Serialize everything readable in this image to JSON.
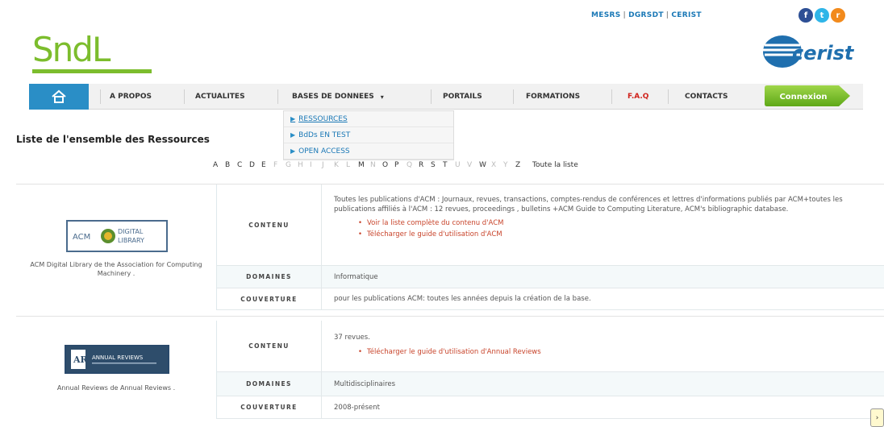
{
  "header": {
    "toplinks": [
      "MESRS",
      "DGRSDT",
      "CERIST"
    ],
    "logo_text": "SndL",
    "cerist_logo_text": "cerist"
  },
  "social": {
    "facebook": "f",
    "twitter": "t",
    "rss": "r"
  },
  "nav": {
    "items": [
      "A PROPOS",
      "ACTUALITES",
      "BASES DE DONNEES",
      "PORTAILS",
      "FORMATIONS",
      "F.A.Q",
      "CONTACTS"
    ],
    "dropdown_caret": "▾",
    "connexion_label": "Connexion"
  },
  "dropdown": {
    "items": [
      "RESSOURCES",
      "BdDs EN TEST",
      "OPEN ACCESS"
    ]
  },
  "page": {
    "title": "Liste de l'ensemble des Ressources"
  },
  "alphabet": {
    "letters": [
      "A",
      "B",
      "C",
      "D",
      "E",
      "F",
      "G",
      "H",
      "I",
      "J",
      "K",
      "L",
      "M",
      "N",
      "O",
      "P",
      "Q",
      "R",
      "S",
      "T",
      "U",
      "V",
      "W",
      "X",
      "Y",
      "Z"
    ],
    "all_label": "Toute la liste"
  },
  "resources": [
    {
      "logo_left": "ACM",
      "logo_right_1": "DIGITAL",
      "logo_right_2": "LIBRARY",
      "caption": "ACM Digital Library de the Association for Computing Machinery .",
      "contenu_label": "CONTENU",
      "contenu_text": "Toutes les publications d'ACM : Journaux, revues, transactions, comptes-rendus de conférences et lettres d'informations publiés par ACM+toutes les publications affiliés à l'ACM : 12 revues, proceedings , bulletins +ACM Guide to Computing Literature, ACM's bibliographic database.",
      "links": [
        "Voir la liste complète du contenu d'ACM",
        "Télécharger le guide d'utilisation d'ACM"
      ],
      "domaines_label": "DOMAINES",
      "domaines_text": "Informatique",
      "couverture_label": "COUVERTURE",
      "couverture_text": "pour les publications ACM: toutes les années depuis la création de la base."
    },
    {
      "logo_left": "AR",
      "logo_right_1": "ANNUAL REVIEWS",
      "logo_right_2": "",
      "caption": "Annual Reviews de Annual Reviews .",
      "contenu_label": "CONTENU",
      "contenu_text": "37 revues.",
      "links": [
        "Télécharger le guide d'utilisation d'Annual Reviews"
      ],
      "domaines_label": "DOMAINES",
      "domaines_text": "Multidisciplinaires",
      "couverture_label": "COUVERTURE",
      "couverture_text": "2008-présent"
    }
  ],
  "colors": {
    "brand_green": "#7cbd2d",
    "nav_blue": "#2a8ec6",
    "faq_red": "#d0231c",
    "link_red": "#c8442b"
  }
}
